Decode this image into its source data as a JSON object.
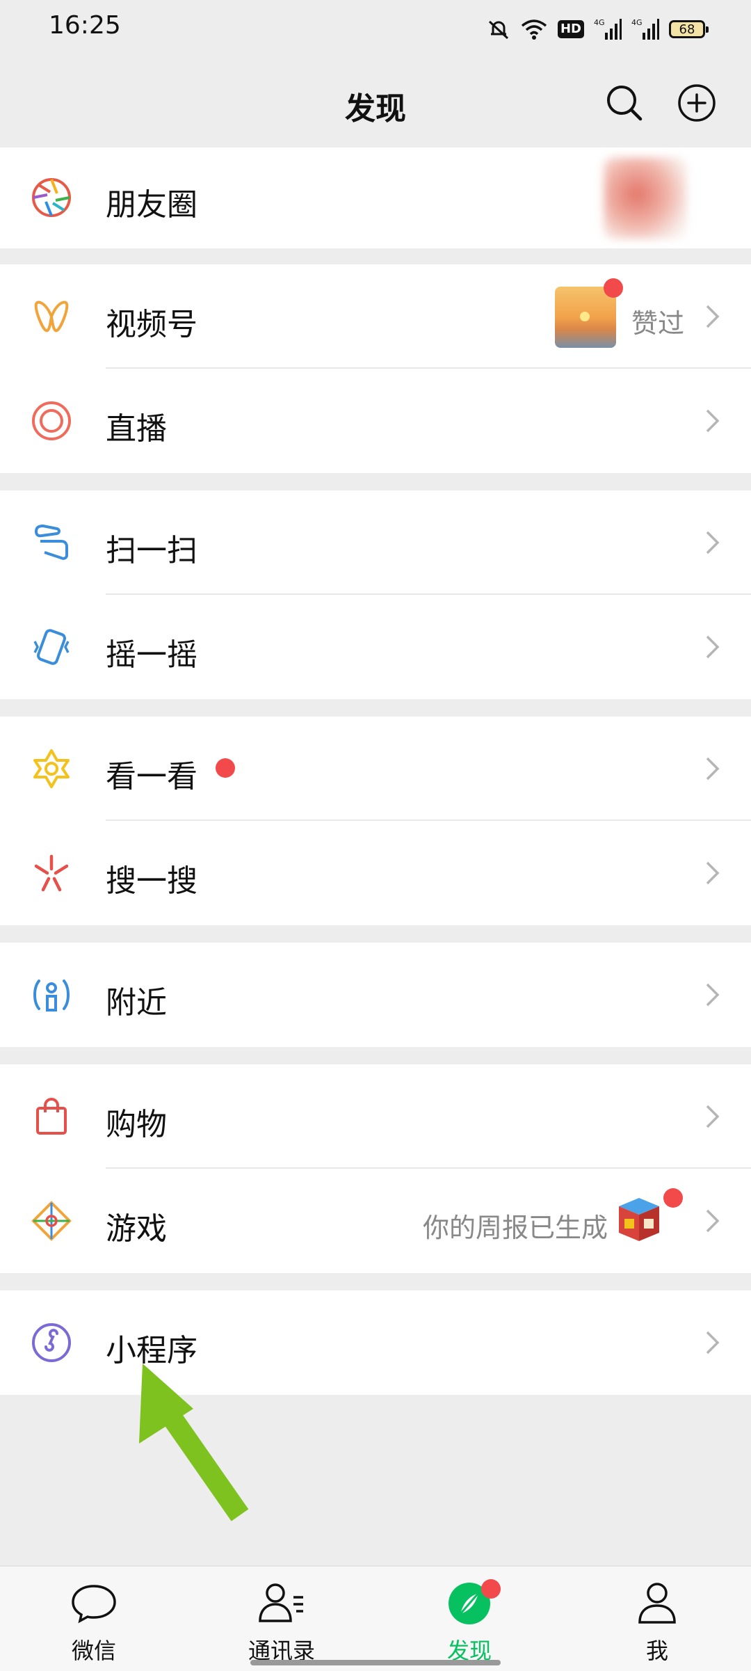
{
  "status": {
    "time": "16:25",
    "hd": "HD",
    "battery": "68"
  },
  "header": {
    "title": "发现"
  },
  "rows": {
    "moments": "朋友圈",
    "channels": "视频号",
    "channels_sub": "赞过",
    "live": "直播",
    "scan": "扫一扫",
    "shake": "摇一摇",
    "top_stories": "看一看",
    "search": "搜一搜",
    "nearby": "附近",
    "shopping": "购物",
    "games": "游戏",
    "games_sub": "你的周报已生成",
    "mini_programs": "小程序"
  },
  "tabbar": {
    "chats": "微信",
    "contacts": "通讯录",
    "discover": "发现",
    "me": "我"
  },
  "colors": {
    "accent": "#07c160",
    "badge": "#f2494b",
    "annotation_arrow": "#7dc21e"
  }
}
